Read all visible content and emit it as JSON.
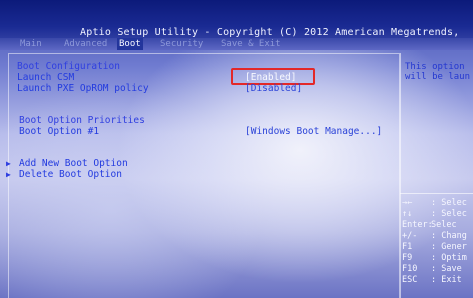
{
  "header": {
    "title": "Aptio Setup Utility - Copyright (C) 2012 American Megatrends,"
  },
  "tabs": [
    {
      "label": "Main"
    },
    {
      "label": "Advanced"
    },
    {
      "label": "Boot"
    },
    {
      "label": "Security"
    },
    {
      "label": "Save & Exit"
    }
  ],
  "main": {
    "boot_configuration": "Boot Configuration",
    "launch_csm_label": "Launch CSM",
    "launch_csm_value": "[Enabled]",
    "launch_pxe_label": "Launch PXE OpROM policy",
    "launch_pxe_value": "[Disabled]",
    "boot_option_priorities": "Boot Option Priorities",
    "boot_option_1_label": "Boot Option #1",
    "boot_option_1_value": "[Windows Boot Manage...]",
    "add_boot_option": "Add New Boot Option",
    "delete_boot_option": "Delete Boot Option"
  },
  "help": {
    "line1": "This option",
    "line2": "will be laun"
  },
  "keys": [
    {
      "key": "→←",
      "desc": ": Selec"
    },
    {
      "key": "↑↓",
      "desc": ": Selec"
    },
    {
      "key": "Enter:",
      "desc": "Selec"
    },
    {
      "key": "+/-",
      "desc": ": Chang"
    },
    {
      "key": "F1",
      "desc": ": Gener"
    },
    {
      "key": "F9",
      "desc": ": Optim"
    },
    {
      "key": "F10",
      "desc": ": Save"
    },
    {
      "key": "ESC",
      "desc": ": Exit"
    }
  ],
  "icons": {
    "submenu_arrow": "▶"
  },
  "colors": {
    "header_bg": "#0c1a7a",
    "highlight_border": "#e32828",
    "label_blue": "#233bdf",
    "selected_white": "#f8f9ff"
  }
}
